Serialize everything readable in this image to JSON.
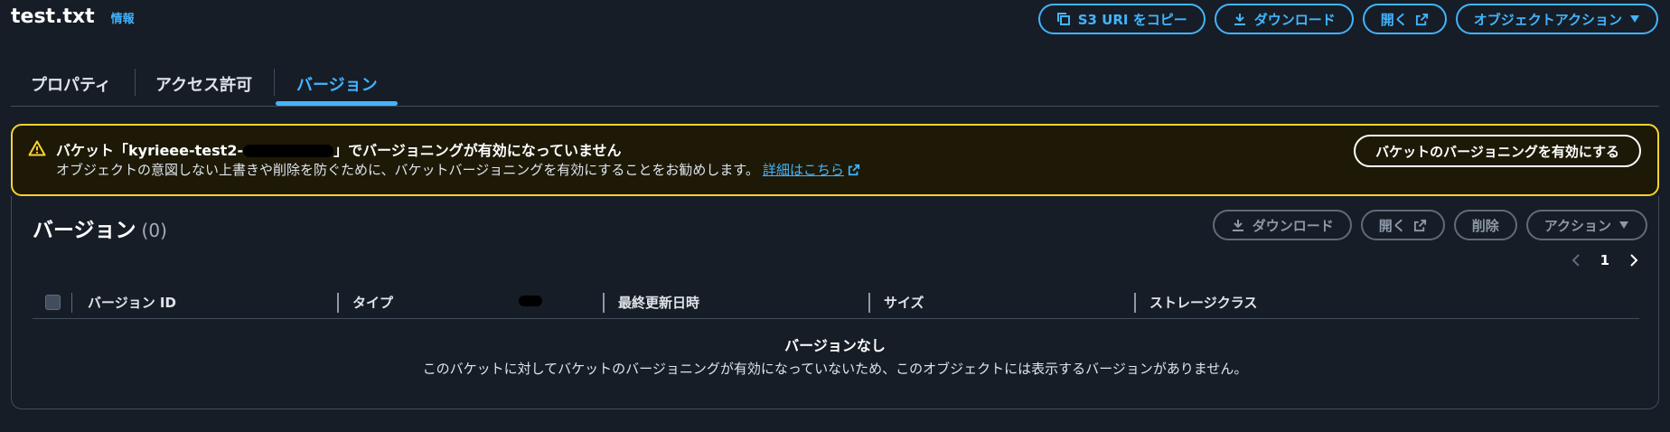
{
  "header": {
    "title": "test.txt",
    "info_link": "情報"
  },
  "top_actions": {
    "copy_uri": "S3 URI をコピー",
    "download": "ダウンロード",
    "open": "開く",
    "object_actions": "オブジェクトアクション"
  },
  "tabs": [
    {
      "label": "プロパティ",
      "active": false
    },
    {
      "label": "アクセス許可",
      "active": false
    },
    {
      "label": "バージョン",
      "active": true
    }
  ],
  "warning": {
    "title_prefix": "バケット「kyrieee-test2-",
    "title_suffix": "」でバージョニングが有効になっていません",
    "body": "オブジェクトの意図しない上書きや削除を防ぐために、バケットバージョニングを有効にすることをお勧めします。",
    "link": "詳細はこちら",
    "button": "バケットのバージョニングを有効にする"
  },
  "versions": {
    "title": "バージョン",
    "count": "(0)",
    "actions": {
      "download": "ダウンロード",
      "open": "開く",
      "delete": "削除",
      "actions": "アクション"
    },
    "page": "1",
    "columns": [
      "バージョン ID",
      "タイプ",
      "最終更新日時",
      "サイズ",
      "ストレージクラス"
    ],
    "empty_title": "バージョンなし",
    "empty_body": "このバケットに対してバケットのバージョニングが有効になっていないため、このオブジェクトには表示するバージョンがありません。"
  },
  "colors": {
    "background": "#161d26",
    "accent": "#42b4ff",
    "warning_border": "#fbd332",
    "warning_bg": "#1d1906"
  }
}
